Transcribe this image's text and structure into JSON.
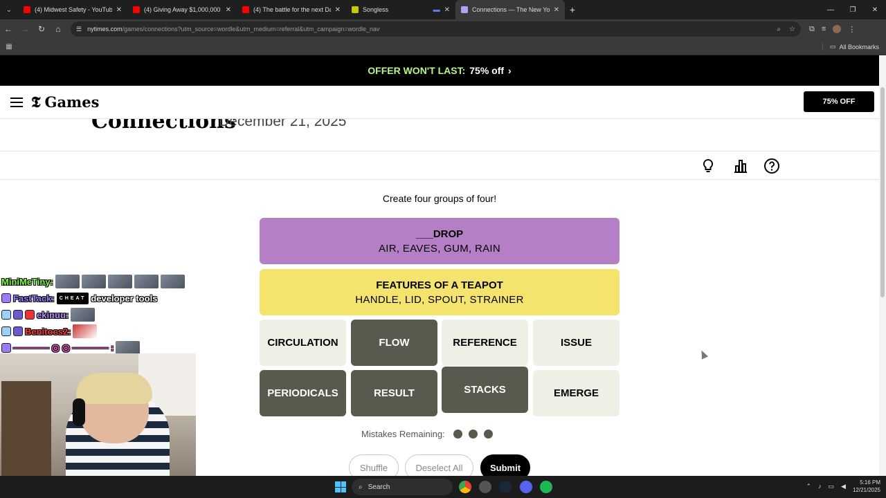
{
  "browser": {
    "tabs": [
      {
        "title": "(4) Midwest Safety - YouTube",
        "favicon_color": "#ff0000"
      },
      {
        "title": "(4) Giving Away $1,000,000 in G",
        "favicon_color": "#ff0000"
      },
      {
        "title": "(4) The battle for the next Dala",
        "favicon_color": "#ff0000"
      },
      {
        "title": "Songless",
        "favicon_color": "#c8c800"
      },
      {
        "title": "Connections — The New York T",
        "favicon_color": "#b6a0f2",
        "active": true
      }
    ],
    "url_host": "nytimes.com",
    "url_path": "/games/connections?utm_source=wordle&utm_medium=referral&utm_campaign=wordle_nav",
    "all_bookmarks_label": "All Bookmarks"
  },
  "promo": {
    "lead": "OFFER WON'T LAST:",
    "text": "75% off"
  },
  "header": {
    "brand": "Games",
    "offer_button": "75% OFF"
  },
  "game": {
    "title": "Connections",
    "date": "December 21, 2025",
    "instructions": "Create four groups of four!",
    "solved_groups": [
      {
        "category": "___DROP",
        "words": "AIR, EAVES, GUM, RAIN",
        "color": "#b47fc4"
      },
      {
        "category": "FEATURES OF A TEAPOT",
        "words": "HANDLE, LID, SPOUT, STRAINER",
        "color": "#f4e36c"
      }
    ],
    "tiles": [
      {
        "word": "CIRCULATION",
        "selected": false
      },
      {
        "word": "FLOW",
        "selected": true
      },
      {
        "word": "REFERENCE",
        "selected": false
      },
      {
        "word": "ISSUE",
        "selected": false
      },
      {
        "word": "PERIODICALS",
        "selected": true
      },
      {
        "word": "RESULT",
        "selected": true
      },
      {
        "word": "STACKS",
        "selected": true
      },
      {
        "word": "EMERGE",
        "selected": false
      }
    ],
    "mistakes_label": "Mistakes Remaining:",
    "mistakes_remaining": 3,
    "buttons": {
      "shuffle": "Shuffle",
      "deselect": "Deselect All",
      "submit": "Submit"
    }
  },
  "overlay": {
    "chat": [
      {
        "user": "MiniMeTiny:",
        "user_color": "#7cff3a",
        "text": ""
      },
      {
        "user": "FastTack:",
        "user_color": "#9b7cff",
        "tag": "CHEAT",
        "text": "developer tools"
      },
      {
        "user": "ekinuu:",
        "user_color": "#b58cff",
        "text": ""
      },
      {
        "user": "Benitocs2:",
        "user_color": "#ff3a3a",
        "text": ""
      },
      {
        "user": "———— ◎ ◎ ———— :",
        "user_color": "#ff5ad9",
        "text": ""
      }
    ]
  },
  "taskbar": {
    "search_label": "Search",
    "time": "5:16 PM",
    "date": "12/21/2025"
  }
}
